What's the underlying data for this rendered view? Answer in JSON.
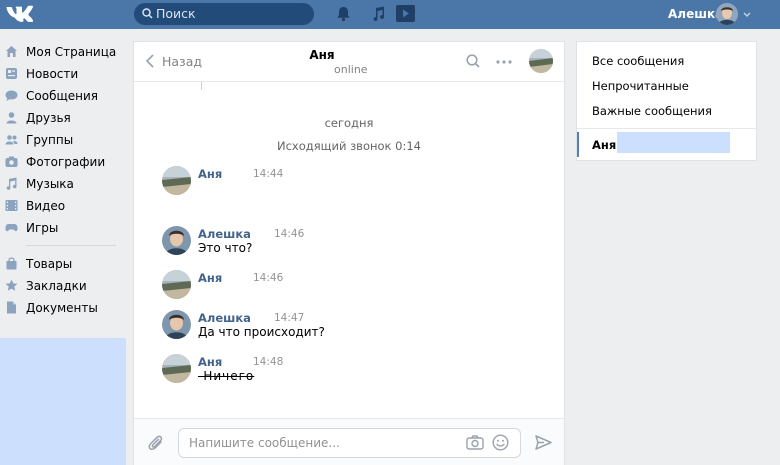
{
  "header": {
    "search_placeholder": "Поиск",
    "user_name": "Алешка",
    "accent": "#4a76a8"
  },
  "nav": {
    "items": [
      {
        "label": "Моя Страница",
        "icon": "home-icon"
      },
      {
        "label": "Новости",
        "icon": "news-icon"
      },
      {
        "label": "Сообщения",
        "icon": "messages-icon"
      },
      {
        "label": "Друзья",
        "icon": "friends-icon"
      },
      {
        "label": "Группы",
        "icon": "groups-icon"
      },
      {
        "label": "Фотографии",
        "icon": "photos-icon"
      },
      {
        "label": "Музыка",
        "icon": "music-icon"
      },
      {
        "label": "Видео",
        "icon": "video-icon"
      },
      {
        "label": "Игры",
        "icon": "games-icon"
      }
    ],
    "secondary": [
      {
        "label": "Товары",
        "icon": "goods-icon"
      },
      {
        "label": "Закладки",
        "icon": "bookmarks-icon"
      },
      {
        "label": "Документы",
        "icon": "documents-icon"
      }
    ]
  },
  "chat": {
    "back_label": "Назад",
    "peer_name": "Аня",
    "peer_status": "online",
    "date_separator": "сегодня",
    "call_note": "Исходящий звонок 0:14",
    "messages": [
      {
        "author": "Аня",
        "time": "14:44",
        "text": ""
      },
      {
        "author": "Алешка",
        "time": "14:46",
        "text": "Это что?"
      },
      {
        "author": "Аня",
        "time": "14:46",
        "text": ""
      },
      {
        "author": "Алешка",
        "time": "14:47",
        "text": "Да что происходит?"
      },
      {
        "author": "Аня",
        "time": "14:48",
        "text": "-Ничего"
      }
    ],
    "composer_placeholder": "Напишите сообщение..."
  },
  "right_panel": {
    "filters": [
      "Все сообщения",
      "Непрочитанные",
      "Важные сообщения"
    ],
    "active_chat": "Аня"
  }
}
